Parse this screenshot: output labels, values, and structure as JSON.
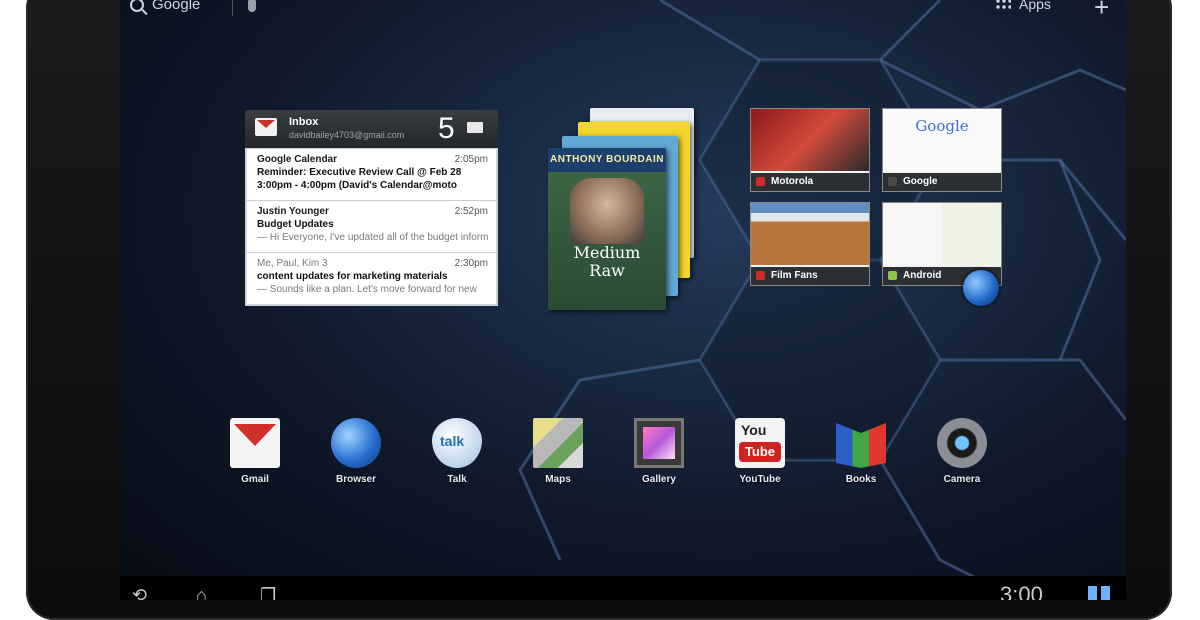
{
  "topbar": {
    "search_label": "Google",
    "apps_label": "Apps",
    "add_label": "+"
  },
  "gmail_widget": {
    "title": "Inbox",
    "account": "davidbailey4703@gmail.com",
    "unread_count": "5",
    "messages": [
      {
        "from": "Google Calendar",
        "time": "2:05pm",
        "subject": "Reminder: Executive Review Call @ Feb 28",
        "snippet": "3:00pm - 4:00pm (David's Calendar@moto"
      },
      {
        "from": "Justin Younger",
        "time": "2:52pm",
        "subject": "Budget Updates",
        "snippet": "— Hi Everyone, I've updated all of the budget information for today's call"
      },
      {
        "from": "Me, Paul, Kim 3",
        "time": "2:30pm",
        "subject": "content updates for marketing materials",
        "snippet": "— Sounds like a plan. Let's move forward for new"
      }
    ]
  },
  "books_widget": {
    "author": "ANTHONY BOURDAIN",
    "title_line1": "Medium",
    "title_line2": "Raw"
  },
  "bookmarks_widget": {
    "items": [
      {
        "label": "Motorola",
        "dot_color": "#d02a2a"
      },
      {
        "label": "Google",
        "dot_color": "#4a4a4a"
      },
      {
        "label": "Film Fans",
        "dot_color": "#d02a2a"
      },
      {
        "label": "Android",
        "dot_color": "#8bc34a"
      }
    ],
    "google_thumb_text": "Google"
  },
  "dock": {
    "apps": [
      {
        "label": "Gmail",
        "icon": "gmail-icon"
      },
      {
        "label": "Browser",
        "icon": "browser-icon"
      },
      {
        "label": "Talk",
        "icon": "talk-icon"
      },
      {
        "label": "Maps",
        "icon": "maps-icon"
      },
      {
        "label": "Gallery",
        "icon": "gallery-icon"
      },
      {
        "label": "YouTube",
        "icon": "youtube-icon"
      },
      {
        "label": "Books",
        "icon": "books-icon"
      },
      {
        "label": "Camera",
        "icon": "camera-icon"
      }
    ],
    "talk_icon_text": "talk",
    "youtube_you": "You",
    "youtube_tube": "Tube"
  },
  "navbar": {
    "clock": "3:00"
  }
}
